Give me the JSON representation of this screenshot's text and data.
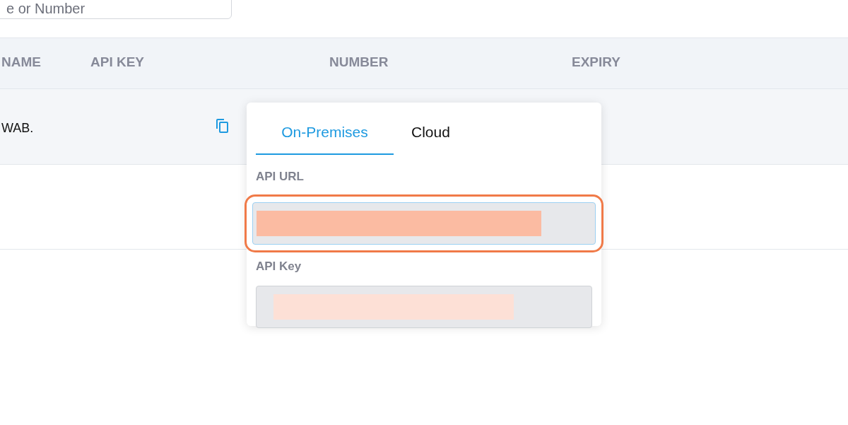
{
  "search": {
    "placeholder": "e or Number"
  },
  "table": {
    "columns": [
      "NAME",
      "API KEY",
      "NUMBER",
      "EXPIRY"
    ],
    "rows": [
      {
        "name": "WAB."
      }
    ]
  },
  "popover": {
    "tabs": [
      {
        "label": "On-Premises",
        "selected": true
      },
      {
        "label": "Cloud",
        "selected": false
      }
    ],
    "fields": [
      {
        "label": "API URL",
        "highlighted": true
      },
      {
        "label": "API Key",
        "highlighted": false
      }
    ]
  }
}
